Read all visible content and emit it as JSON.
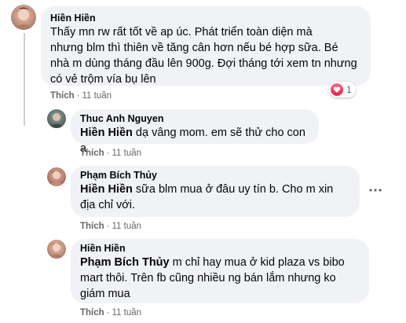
{
  "comments": [
    {
      "author": "Hiền Hiền",
      "lines": [
        "Thấy mn rw rất tốt về ap úc. Phát triển toàn diện mà",
        "nhưng blm thì thiên về tăng cân hơn nếu bé hợp sữa. Bé",
        "nhà m dùng tháng đầu lên 900g. Đợi tháng tới xem tn nhưng",
        "có vẻ trộm vía bụ lên"
      ],
      "like_label": "Thích",
      "time": "11 tuần",
      "reaction_count": "1"
    }
  ],
  "replies": [
    {
      "author": "Thuc Anh Nguyen",
      "mention": "Hiền Hiền",
      "lines": [
        "dạ vâng mom. em sẽ thử cho con ạ"
      ],
      "like_label": "Thích",
      "time": "11 tuần"
    },
    {
      "author": "Phạm Bích Thủy",
      "mention": "Hiền Hiền",
      "lines": [
        "sữa blm mua ở đâu uy tín b. Cho m xin",
        "địa chỉ với."
      ],
      "like_label": "Thích",
      "time": "11 tuần"
    },
    {
      "author": "Hiền Hiền",
      "mention": "Phạm Bích Thủy",
      "lines": [
        "m chỉ hay mua ở kid plaza vs bibo",
        "mart thôi. Trên fb cũng nhiều ng bán lắm nhưng ko",
        "giám mua"
      ],
      "like_label": "Thích",
      "time": "11 tuần"
    }
  ],
  "separator": "·",
  "icons": [
    "heart-reaction-icon",
    "more-options-icon"
  ],
  "colors": {
    "bubble": "#f0f2f5",
    "meta": "#65676b",
    "heart": "#f33e58"
  }
}
